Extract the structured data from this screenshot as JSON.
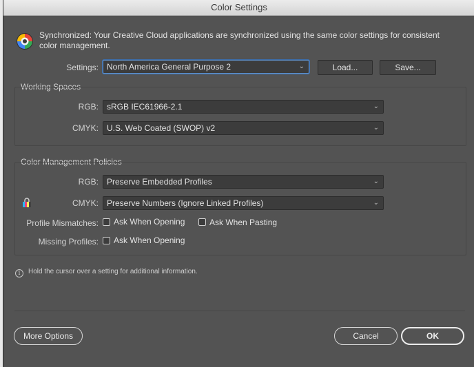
{
  "window": {
    "title": "Color Settings"
  },
  "sync": {
    "icon": "color-wheel-icon",
    "message": "Synchronized: Your Creative Cloud applications are synchronized using the same color settings for consistent color management."
  },
  "settings": {
    "label": "Settings:",
    "value": "North America General Purpose 2",
    "load_label": "Load...",
    "save_label": "Save..."
  },
  "working_spaces": {
    "title": "Working Spaces",
    "rgb_label": "RGB:",
    "rgb_value": "sRGB IEC61966-2.1",
    "cmyk_label": "CMYK:",
    "cmyk_value": "U.S. Web Coated (SWOP) v2"
  },
  "policies": {
    "title": "Color Management Policies",
    "rgb_label": "RGB:",
    "rgb_value": "Preserve Embedded Profiles",
    "cmyk_icon": "lock-icon",
    "cmyk_label": "CMYK:",
    "cmyk_value": "Preserve Numbers (Ignore Linked Profiles)",
    "profile_mismatches_label": "Profile Mismatches:",
    "ask_when_opening_label": "Ask When Opening",
    "ask_when_opening_checked": false,
    "ask_when_pasting_label": "Ask When Pasting",
    "ask_when_pasting_checked": false,
    "missing_profiles_label": "Missing Profiles:",
    "missing_ask_when_opening_label": "Ask When Opening",
    "missing_ask_when_opening_checked": false
  },
  "info": {
    "icon": "info-icon",
    "text": "Hold the cursor over a setting for additional information."
  },
  "footer": {
    "more_options_label": "More Options",
    "cancel_label": "Cancel",
    "ok_label": "OK"
  },
  "colors": {
    "dialog_bg": "#535353",
    "field_bg": "#3c3c3c",
    "focus_ring": "#5e8fc9"
  }
}
